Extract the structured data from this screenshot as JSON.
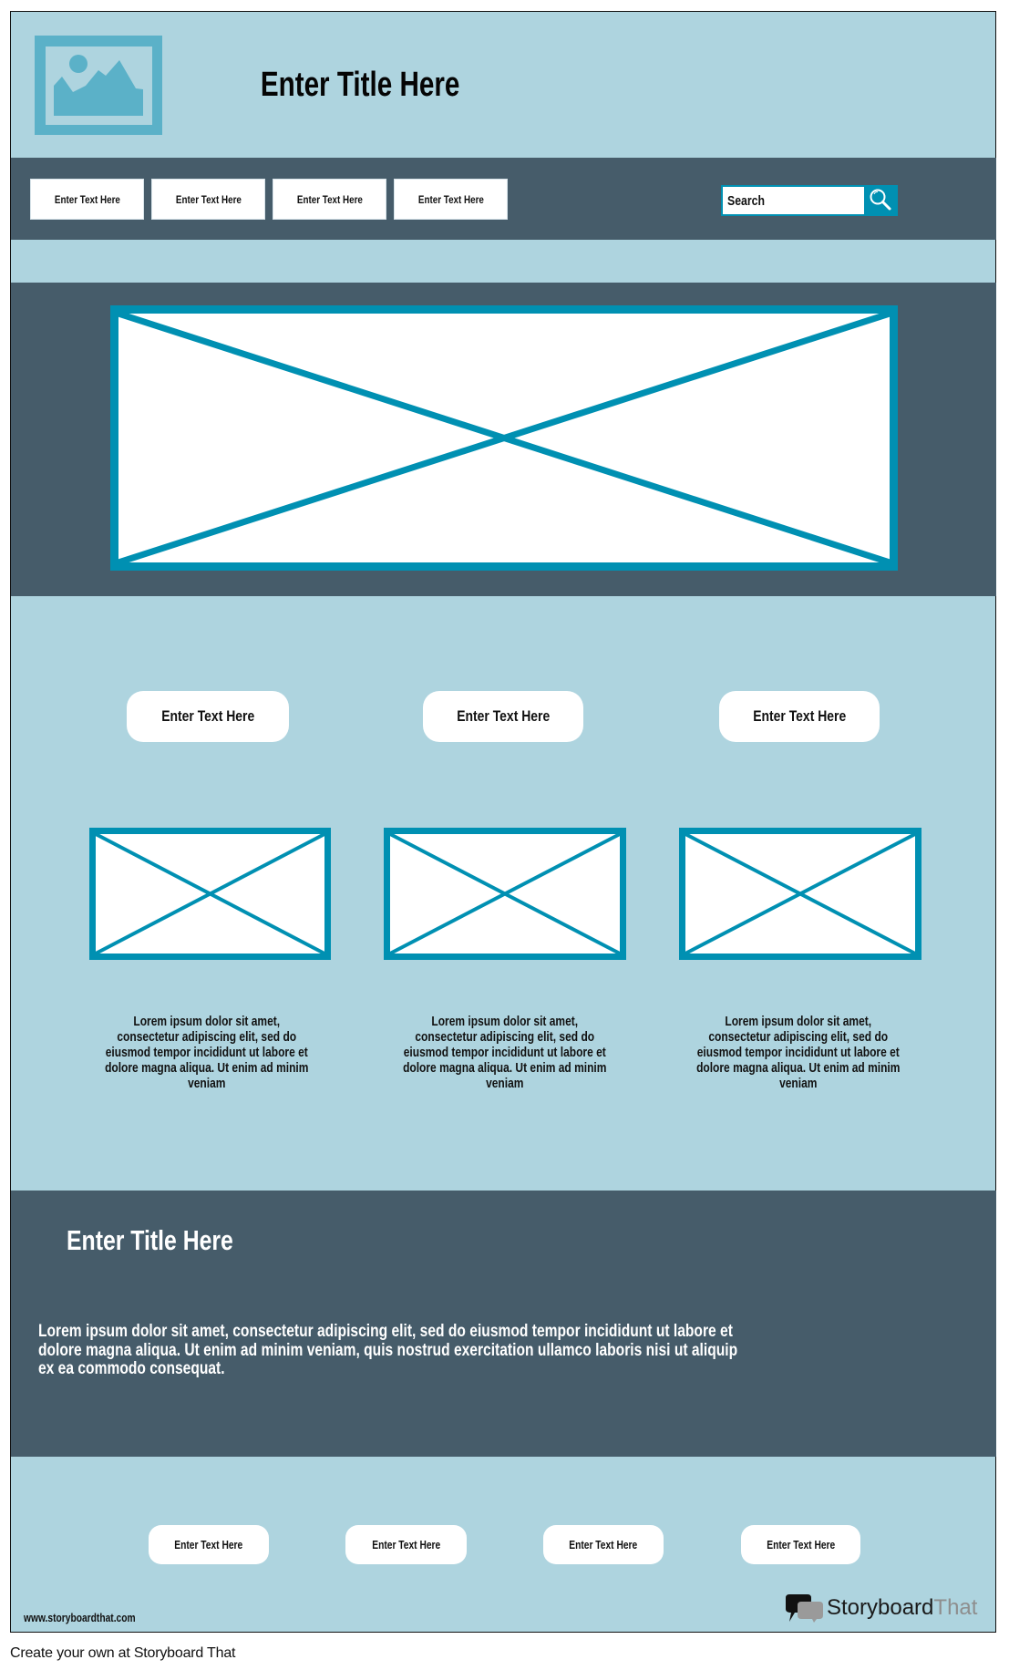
{
  "header": {
    "logo_icon": "image-placeholder-icon",
    "title": "Enter Title Here"
  },
  "nav": {
    "items": [
      {
        "label": "Enter Text Here"
      },
      {
        "label": "Enter Text Here"
      },
      {
        "label": "Enter Text Here"
      },
      {
        "label": "Enter Text Here"
      }
    ],
    "search": {
      "value": "Search",
      "button_icon": "magnifier-icon"
    }
  },
  "hero": {
    "image_icon": "image-placeholder-icon"
  },
  "columns": [
    {
      "button_label": "Enter Text Here",
      "image_icon": "image-placeholder-icon",
      "text": "Lorem ipsum dolor sit amet, consectetur adipiscing elit, sed do eiusmod tempor incididunt ut labore et dolore magna aliqua. Ut enim ad minim veniam"
    },
    {
      "button_label": "Enter Text Here",
      "image_icon": "image-placeholder-icon",
      "text": "Lorem ipsum dolor sit amet, consectetur adipiscing elit, sed do eiusmod tempor incididunt ut labore et dolore magna aliqua. Ut enim ad minim veniam"
    },
    {
      "button_label": "Enter Text Here",
      "image_icon": "image-placeholder-icon",
      "text": "Lorem ipsum dolor sit amet, consectetur adipiscing elit, sed do eiusmod tempor incididunt ut labore et dolore magna aliqua. Ut enim ad minim veniam"
    }
  ],
  "feature": {
    "title": "Enter Title Here",
    "body_lines": [
      "Lorem ipsum dolor sit amet, consectetur adipiscing elit, sed do eiusmod tempor incididunt ut labore et",
      "dolore magna aliqua. Ut enim ad minim veniam, quis nostrud exercitation ullamco laboris nisi ut aliquip",
      "ex ea commodo consequat."
    ]
  },
  "footer": {
    "buttons": [
      {
        "label": "Enter Text Here"
      },
      {
        "label": "Enter Text Here"
      },
      {
        "label": "Enter Text Here"
      },
      {
        "label": "Enter Text Here"
      }
    ],
    "url": "www.storyboardthat.com",
    "brand": {
      "part1": "Storyboard",
      "part2": "That",
      "icon": "speech-bubbles-icon"
    }
  },
  "caption": "Create your own at Storyboard That",
  "colors": {
    "background_light": "#AED4DF",
    "band_dark": "#465C6A",
    "accent_teal": "#0090B2",
    "logo_blue": "#5BB1C8"
  }
}
